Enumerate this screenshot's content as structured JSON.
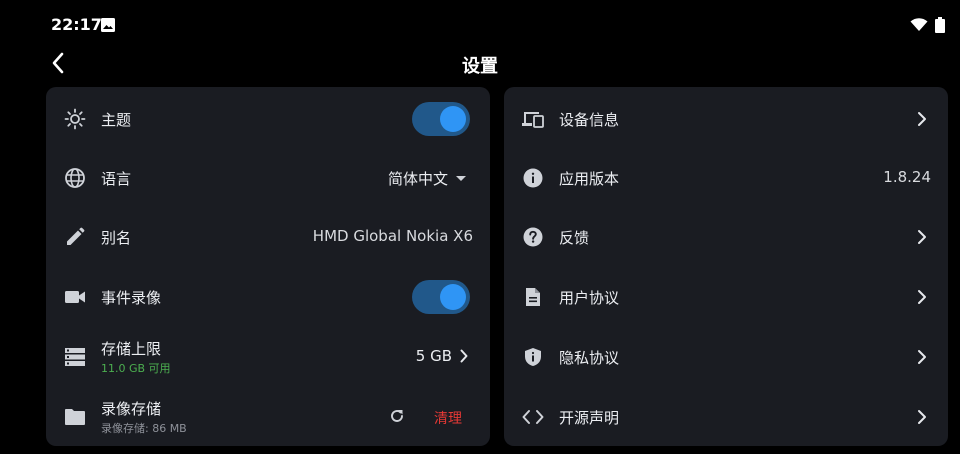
{
  "status_bar": {
    "time": "22:17",
    "icons": [
      "image-icon",
      "wifi-icon",
      "battery-icon"
    ]
  },
  "header": {
    "title": "设置"
  },
  "left_panel": {
    "theme": {
      "label": "主题",
      "toggle_on": true
    },
    "language": {
      "label": "语言",
      "value": "简体中文"
    },
    "alias": {
      "label": "别名",
      "value": "HMD Global Nokia X6"
    },
    "event_recording": {
      "label": "事件录像",
      "toggle_on": true
    },
    "storage_limit": {
      "label": "存储上限",
      "sub": "11.0 GB 可用",
      "value": "5 GB"
    },
    "recording_storage": {
      "label": "录像存储",
      "sub": "录像存储: 86 MB",
      "clear_label": "清理"
    }
  },
  "right_panel": {
    "device_info": {
      "label": "设备信息"
    },
    "app_version": {
      "label": "应用版本",
      "value": "1.8.24"
    },
    "feedback": {
      "label": "反馈"
    },
    "user_agreement": {
      "label": "用户协议"
    },
    "privacy_policy": {
      "label": "隐私协议"
    },
    "open_source": {
      "label": "开源声明"
    }
  },
  "colors": {
    "background": "#000000",
    "card": "#1a1c22",
    "toggle_track": "#21588a",
    "toggle_knob": "#2f95f5",
    "available_green": "#4caf50",
    "clear_red": "#e53935"
  }
}
